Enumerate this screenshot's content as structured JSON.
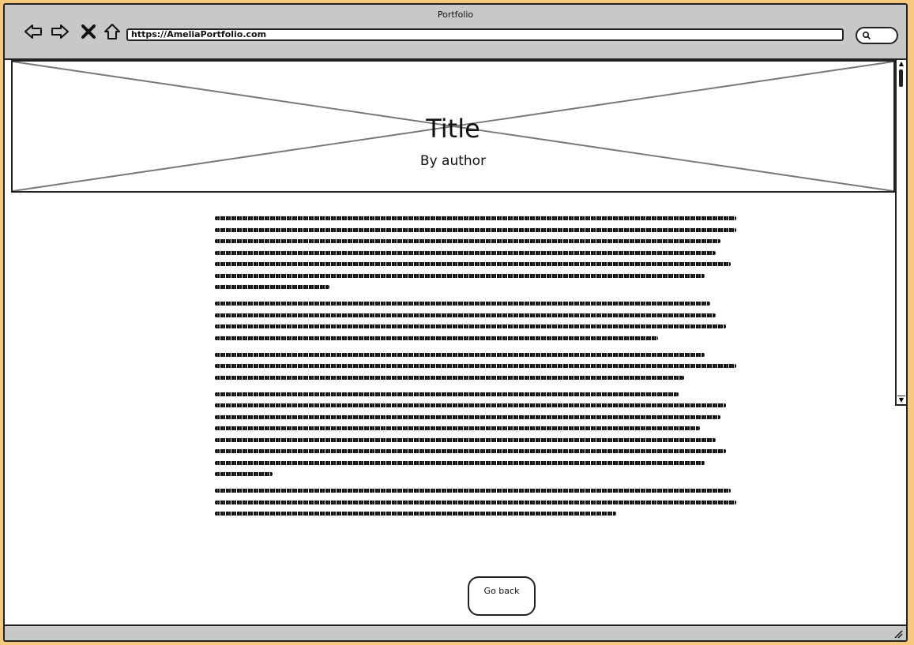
{
  "window": {
    "title": "Portfolio"
  },
  "toolbar": {
    "url": "https://AmeliaPortfolio.com"
  },
  "hero": {
    "title": "Title",
    "author": "By author"
  },
  "article": {
    "paragraphs": [
      {
        "lines": [
          1.0,
          1.0,
          0.97,
          0.96,
          0.99,
          0.94,
          0.22
        ]
      },
      {
        "lines": [
          0.95,
          0.96,
          0.98,
          0.85
        ]
      },
      {
        "lines": [
          0.94,
          1.0,
          0.9
        ]
      },
      {
        "lines": [
          0.89,
          0.98,
          0.97,
          0.93,
          0.96,
          0.98,
          0.94,
          0.11
        ]
      },
      {
        "lines": [
          0.99,
          1.0,
          0.77
        ]
      }
    ]
  },
  "actions": {
    "go_back_label": "Go back"
  },
  "icons": [
    "back-arrow-icon",
    "forward-arrow-icon",
    "stop-icon",
    "home-icon",
    "search-icon",
    "resize-grip-icon"
  ]
}
